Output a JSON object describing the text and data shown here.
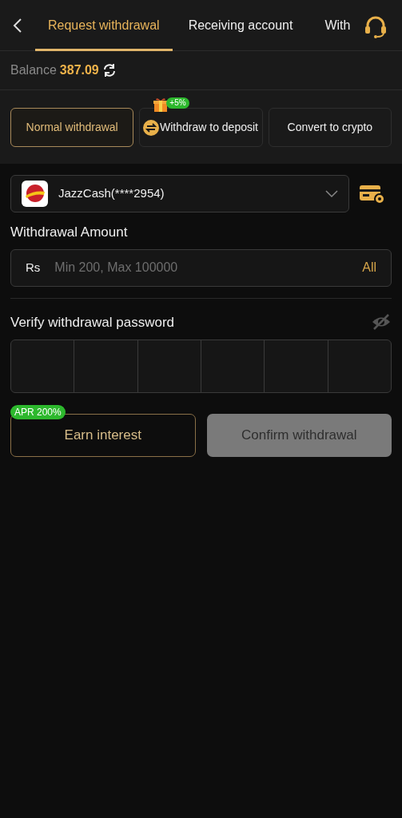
{
  "tabs": [
    {
      "label": "Request withdrawal",
      "selected": true
    },
    {
      "label": "Receiving account",
      "selected": false
    },
    {
      "label": "With",
      "selected": false
    }
  ],
  "balance": {
    "label": "Balance",
    "value": "387.09"
  },
  "modes": [
    {
      "label": "Normal withdrawal",
      "selected": true,
      "kind": "plain"
    },
    {
      "label": "Withdraw to deposit",
      "selected": false,
      "kind": "exchange",
      "badge": "+5%"
    },
    {
      "label": "Convert to crypto",
      "selected": false,
      "kind": "plain"
    }
  ],
  "account": {
    "name": "JazzCash(****2954)"
  },
  "amount": {
    "label": "Withdrawal Amount",
    "currency": "Rs",
    "placeholder": "Min 200, Max 100000",
    "all": "All"
  },
  "password": {
    "label": "Verify withdrawal password",
    "visible": false
  },
  "earn": {
    "label": "Earn interest",
    "badge": "APR 200%"
  },
  "confirm": {
    "label": "Confirm withdrawal",
    "disabled": true
  }
}
